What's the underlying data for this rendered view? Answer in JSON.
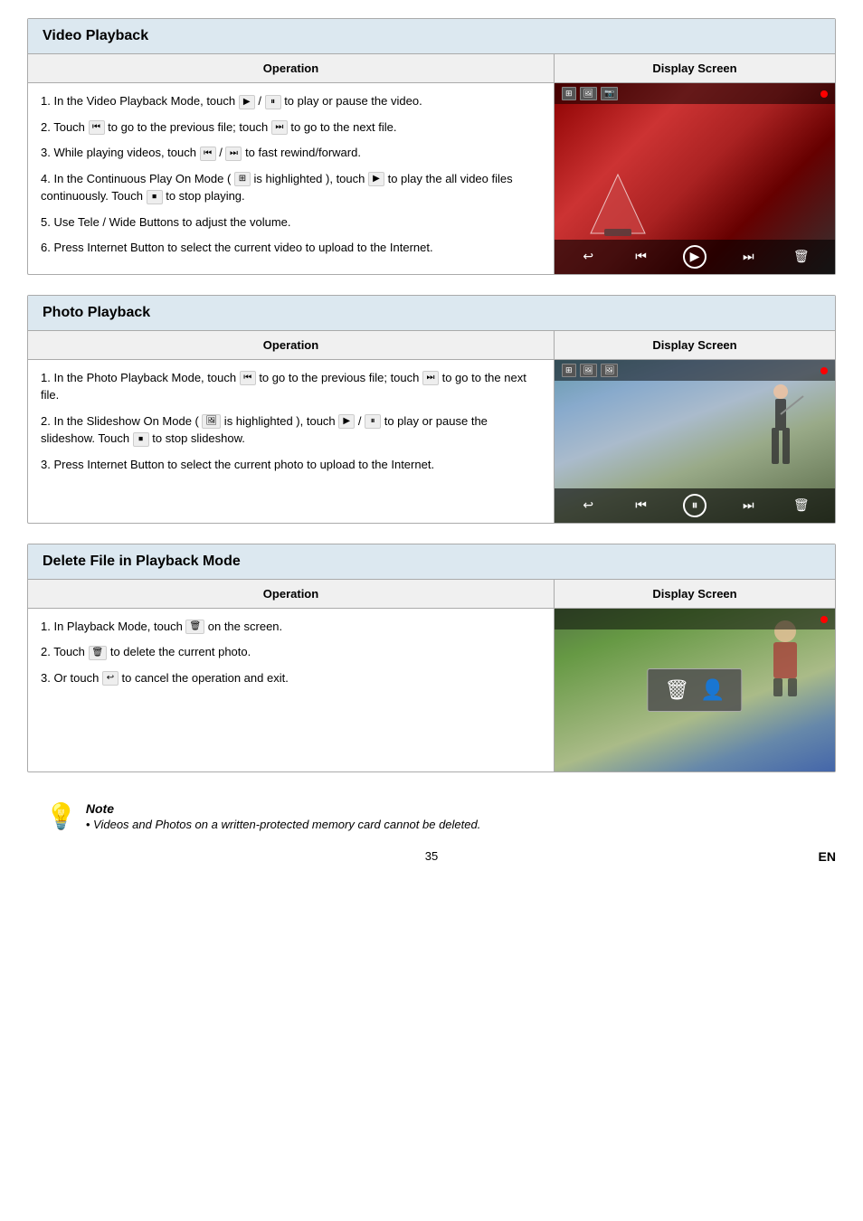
{
  "sections": [
    {
      "id": "video-playback",
      "title": "Video Playback",
      "operation_header": "Operation",
      "display_header": "Display Screen",
      "items": [
        {
          "num": "1.",
          "text_before": "In the Video Playback Mode, touch",
          "icon1": "▶",
          "text_mid": "/",
          "icon2": "⏸",
          "text_after": "to play or pause the video."
        },
        {
          "num": "2.",
          "text_before": "Touch",
          "icon1": "⏮",
          "text_mid": "to go to the previous file; touch",
          "icon2": "⏭",
          "text_after": "to go to the next file."
        },
        {
          "num": "3.",
          "text_before": "While playing videos, touch",
          "icon1": "⏮",
          "text_mid": "/",
          "icon2": "⏭",
          "text_after": "to fast rewind/forward."
        },
        {
          "num": "4.",
          "text_before": "In the Continuous Play On Mode (",
          "icon1": "🎞",
          "text_mid": "is highlighted ), touch",
          "icon2": "▶",
          "text_after": "to play the all video files continuously. Touch",
          "icon3": "⏹",
          "text_end": "to stop playing."
        },
        {
          "num": "5.",
          "text_before": "Use Tele / Wide Buttons to adjust the volume."
        },
        {
          "num": "6.",
          "text_before": "Press Internet Button to select the current video to upload to the Internet."
        }
      ]
    },
    {
      "id": "photo-playback",
      "title": "Photo Playback",
      "operation_header": "Operation",
      "display_header": "Display Screen",
      "items": [
        {
          "num": "1.",
          "text_before": "In the Photo Playback Mode, touch",
          "icon1": "⏮",
          "text_mid": "to go to the previous file; touch",
          "icon2": "⏭",
          "text_after": "to go to the next file."
        },
        {
          "num": "2.",
          "text_before": "In the Slideshow On Mode (",
          "icon1": "🖼",
          "text_mid": "is highlighted ), touch",
          "icon2": "▶",
          "text_after": "/",
          "icon3": "⏸",
          "text_mid2": "to play or pause the slideshow. Touch",
          "icon4": "⏹",
          "text_end": "to stop slideshow."
        },
        {
          "num": "3.",
          "text_before": "Press Internet Button to select the current photo to upload to the Internet."
        }
      ]
    },
    {
      "id": "delete-file",
      "title": "Delete File in Playback Mode",
      "operation_header": "Operation",
      "display_header": "Display Screen",
      "items": [
        {
          "num": "1.",
          "text_before": "In Playback Mode, touch",
          "icon1": "🗑",
          "text_after": "on the screen."
        },
        {
          "num": "2.",
          "text_before": "Touch",
          "icon1": "🗑",
          "text_after": "to delete the current photo."
        },
        {
          "num": "3.",
          "text_before": "Or touch",
          "icon1": "↩",
          "text_after": "to cancel the operation and exit."
        }
      ]
    }
  ],
  "note": {
    "title": "Note",
    "bullet": "Videos and Photos on a written-protected memory card cannot be deleted."
  },
  "footer": {
    "page_number": "35",
    "lang": "EN"
  }
}
